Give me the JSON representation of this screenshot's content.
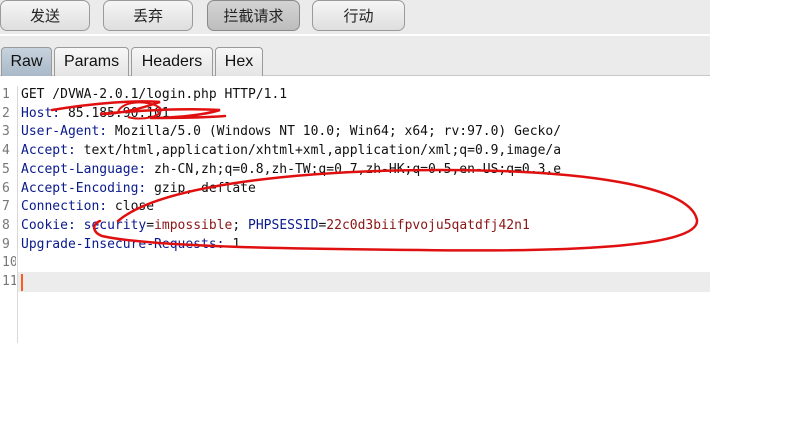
{
  "toolbar": {
    "buttons": [
      {
        "label": "发送",
        "active": false
      },
      {
        "label": "丢弃",
        "active": false
      },
      {
        "label": "拦截请求",
        "active": true
      },
      {
        "label": "行动",
        "active": false
      }
    ]
  },
  "tabs": [
    {
      "label": "Raw",
      "active": true
    },
    {
      "label": "Params",
      "active": false
    },
    {
      "label": "Headers",
      "active": false
    },
    {
      "label": "Hex",
      "active": false
    }
  ],
  "editor": {
    "line_numbers": [
      "1",
      "2",
      "3",
      "4",
      "5",
      "6",
      "7",
      "8",
      "9",
      "10",
      "11"
    ],
    "request_line": "GET /DVWA-2.0.1/login.php HTTP/1.1",
    "host": {
      "name": "Host:",
      "value": " 85.185.90.101"
    },
    "user_agent": {
      "name": "User-Agent:",
      "value": " Mozilla/5.0 (Windows NT 10.0; Win64; x64; rv:97.0) Gecko/"
    },
    "accept": {
      "name": "Accept:",
      "value": " text/html,application/xhtml+xml,application/xml;q=0.9,image/a"
    },
    "accept_language": {
      "name": "Accept-Language:",
      "value": " zh-CN,zh;q=0.8,zh-TW;q=0.7,zh-HK;q=0.5,en-US;q=0.3,e"
    },
    "accept_encoding": {
      "name": "Accept-Encoding:",
      "value": " gzip, deflate"
    },
    "connection": {
      "name": "Connection:",
      "value": " close"
    },
    "cookie": {
      "name": "Cookie:",
      "security_key": "security",
      "security_value": "impossible",
      "sep": "; ",
      "session_key": "PHPSESSID",
      "session_value": "22c0d3biifpvoju5qatdfj42n1"
    },
    "upgrade": {
      "name": "Upgrade-Insecure-Requests:",
      "value": " 1"
    }
  },
  "colors": {
    "header_name": "#0a1a8c",
    "cookie_value": "#8b1616",
    "caret": "#ff5a1f",
    "annotation": "#e01010"
  }
}
